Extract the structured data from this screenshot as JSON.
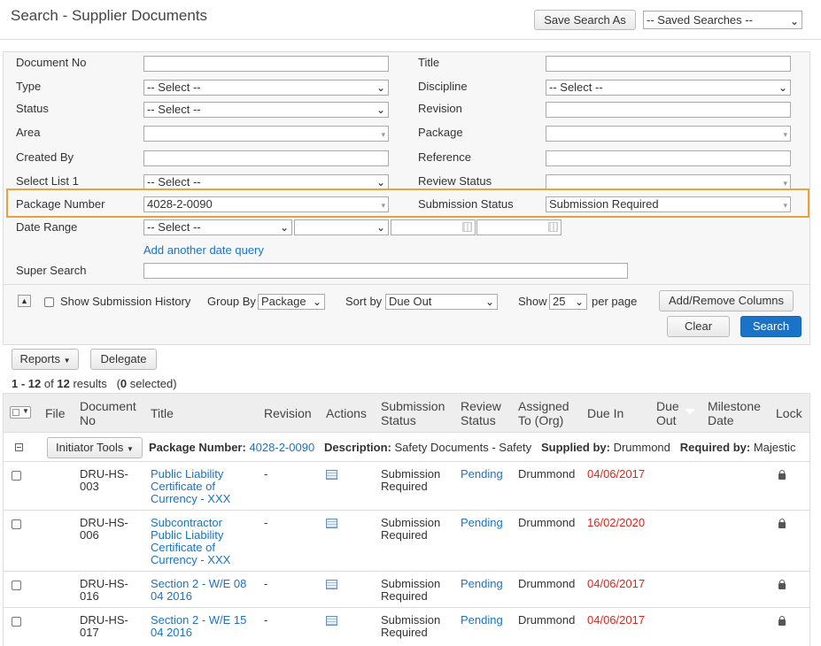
{
  "header": {
    "title": "Search - Supplier Documents",
    "save_search_label": "Save Search As",
    "saved_searches_value": "-- Saved Searches --"
  },
  "form": {
    "document_no_label": "Document No",
    "title_label": "Title",
    "type_label": "Type",
    "type_value": "-- Select --",
    "discipline_label": "Discipline",
    "discipline_value": "-- Select --",
    "status_label": "Status",
    "status_value": "-- Select --",
    "revision_label": "Revision",
    "area_label": "Area",
    "package_label": "Package",
    "created_by_label": "Created By",
    "reference_label": "Reference",
    "select_list_1_label": "Select List 1",
    "select_list_1_value": "-- Select --",
    "review_status_label": "Review Status",
    "package_number_label": "Package Number",
    "package_number_value": "4028-2-0090",
    "submission_status_label": "Submission Status",
    "submission_status_value": "Submission Required",
    "date_range_label": "Date Range",
    "date_range_value": "-- Select --",
    "add_date_query_label": "Add another date query",
    "super_search_label": "Super Search"
  },
  "options": {
    "show_history_label": "Show Submission History",
    "group_by_label": "Group By",
    "group_by_value": "Package",
    "sort_by_label": "Sort by",
    "sort_by_value": "Due Out",
    "show_label": "Show",
    "show_value": "25",
    "per_page_label": "per page",
    "add_remove_columns_label": "Add/Remove Columns",
    "clear_label": "Clear",
    "search_label": "Search"
  },
  "results": {
    "reports_label": "Reports",
    "delegate_label": "Delegate",
    "summary_range": "1 - 12",
    "summary_of": "of",
    "summary_total": "12",
    "summary_results": "results",
    "summary_selected_count": "0",
    "summary_selected": "selected"
  },
  "columns": {
    "file": "File",
    "document_no": "Document No",
    "title": "Title",
    "revision": "Revision",
    "actions": "Actions",
    "submission_status": "Submission Status",
    "review_status": "Review Status",
    "assigned_to": "Assigned To (Org)",
    "due_in": "Due In",
    "due_out": "Due Out",
    "milestone_date": "Milestone Date",
    "lock": "Lock"
  },
  "group": {
    "initiator_tools_label": "Initiator Tools",
    "package_number_label": "Package Number:",
    "package_number_value": "4028-2-0090",
    "description_label": "Description:",
    "description_value": "Safety Documents - Safety",
    "supplied_by_label": "Supplied by:",
    "supplied_by_value": "Drummond",
    "required_by_label": "Required by:",
    "required_by_value": "Majestic"
  },
  "rows": [
    {
      "doc_no": "DRU-HS-003",
      "title": "Public Liability Certificate of Currency - XXX",
      "revision": "-",
      "submission_status": "Submission Required",
      "review_status": "Pending",
      "assigned_to": "Drummond",
      "due_in": "04/06/2017"
    },
    {
      "doc_no": "DRU-HS-006",
      "title": "Subcontractor Public Liability Certificate of Currency - XXX",
      "revision": "-",
      "submission_status": "Submission Required",
      "review_status": "Pending",
      "assigned_to": "Drummond",
      "due_in": "16/02/2020"
    },
    {
      "doc_no": "DRU-HS-016",
      "title": "Section 2 - W/E 08 04 2016",
      "revision": "-",
      "submission_status": "Submission Required",
      "review_status": "Pending",
      "assigned_to": "Drummond",
      "due_in": "04/06/2017"
    },
    {
      "doc_no": "DRU-HS-017",
      "title": "Section 2 - W/E 15 04 2016",
      "revision": "-",
      "submission_status": "Submission Required",
      "review_status": "Pending",
      "assigned_to": "Drummond",
      "due_in": "04/06/2017"
    }
  ]
}
